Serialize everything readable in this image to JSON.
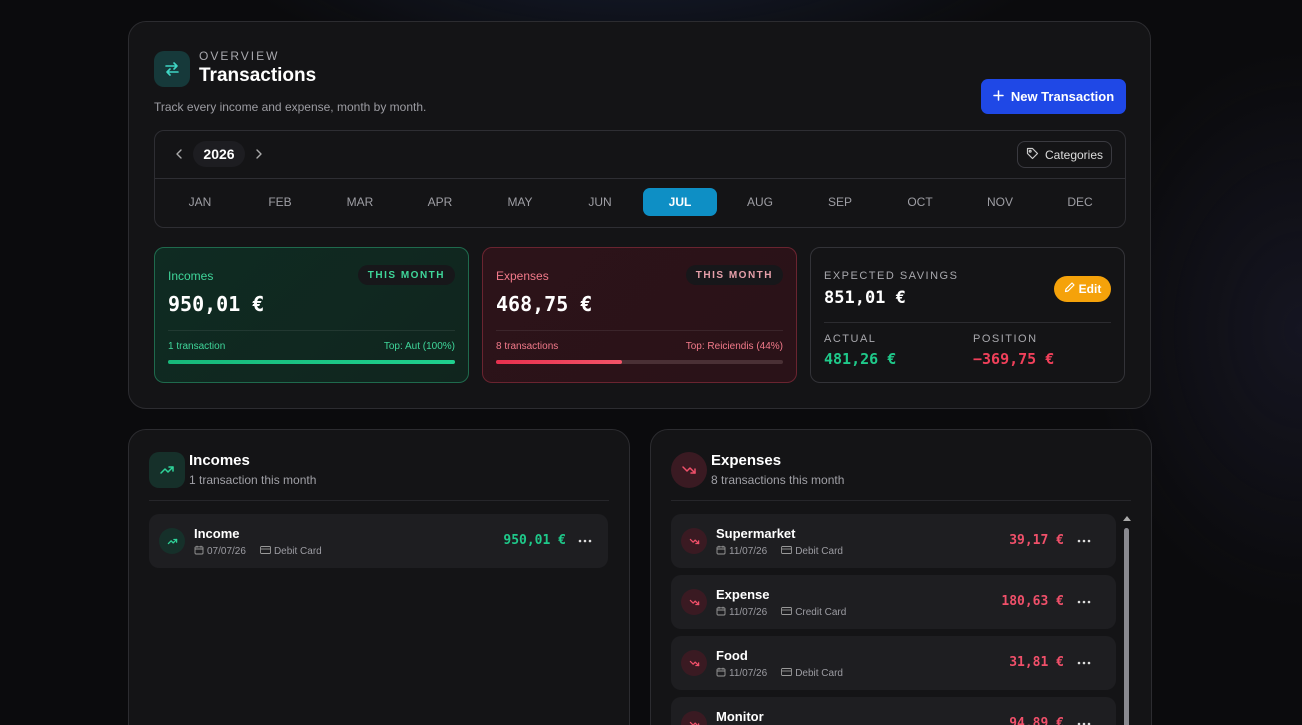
{
  "overview": {
    "eyebrow": "OVERVIEW",
    "title": "Transactions",
    "subtitle": "Track every income and expense, month by month.",
    "new_button": "New Transaction",
    "year": "2026",
    "categories_button": "Categories",
    "months": [
      "JAN",
      "FEB",
      "MAR",
      "APR",
      "MAY",
      "JUN",
      "JUL",
      "AUG",
      "SEP",
      "OCT",
      "NOV",
      "DEC"
    ],
    "active_month": "JUL"
  },
  "summary": {
    "incomes": {
      "label": "Incomes",
      "badge": "THIS MONTH",
      "amount": "950,01 €",
      "count": "1 transaction",
      "top": "Top: Aut (100%)",
      "progress": 1.0,
      "color": "#1fc98a"
    },
    "expenses": {
      "label": "Expenses",
      "badge": "THIS MONTH",
      "amount": "468,75 €",
      "count": "8 transactions",
      "top": "Top: Reiciendis (44%)",
      "progress": 0.44,
      "color": "#f0405a"
    },
    "savings": {
      "label": "EXPECTED SAVINGS",
      "amount": "851,01 €",
      "edit_button": "Edit",
      "actual_label": "ACTUAL",
      "actual_value": "481,26 €",
      "position_label": "POSITION",
      "position_value": "−369,75 €"
    }
  },
  "incomes_section": {
    "title": "Incomes",
    "subtitle": "1 transaction this month",
    "items": [
      {
        "name": "Income",
        "date": "07/07/26",
        "method": "Debit Card",
        "amount": "950,01 €"
      }
    ]
  },
  "expenses_section": {
    "title": "Expenses",
    "subtitle": "8 transactions this month",
    "items": [
      {
        "name": "Supermarket",
        "date": "11/07/26",
        "method": "Debit Card",
        "amount": "39,17 €"
      },
      {
        "name": "Expense",
        "date": "11/07/26",
        "method": "Credit Card",
        "amount": "180,63 €"
      },
      {
        "name": "Food",
        "date": "11/07/26",
        "method": "Debit Card",
        "amount": "31,81 €"
      },
      {
        "name": "Monitor",
        "date": "",
        "method": "",
        "amount": "94,89 €"
      }
    ]
  },
  "colors": {
    "income": "#1fc98a",
    "expense": "#f0405a",
    "accent": "#1f48e6",
    "month_active": "#0e8fc5",
    "edit": "#f5a20a"
  }
}
